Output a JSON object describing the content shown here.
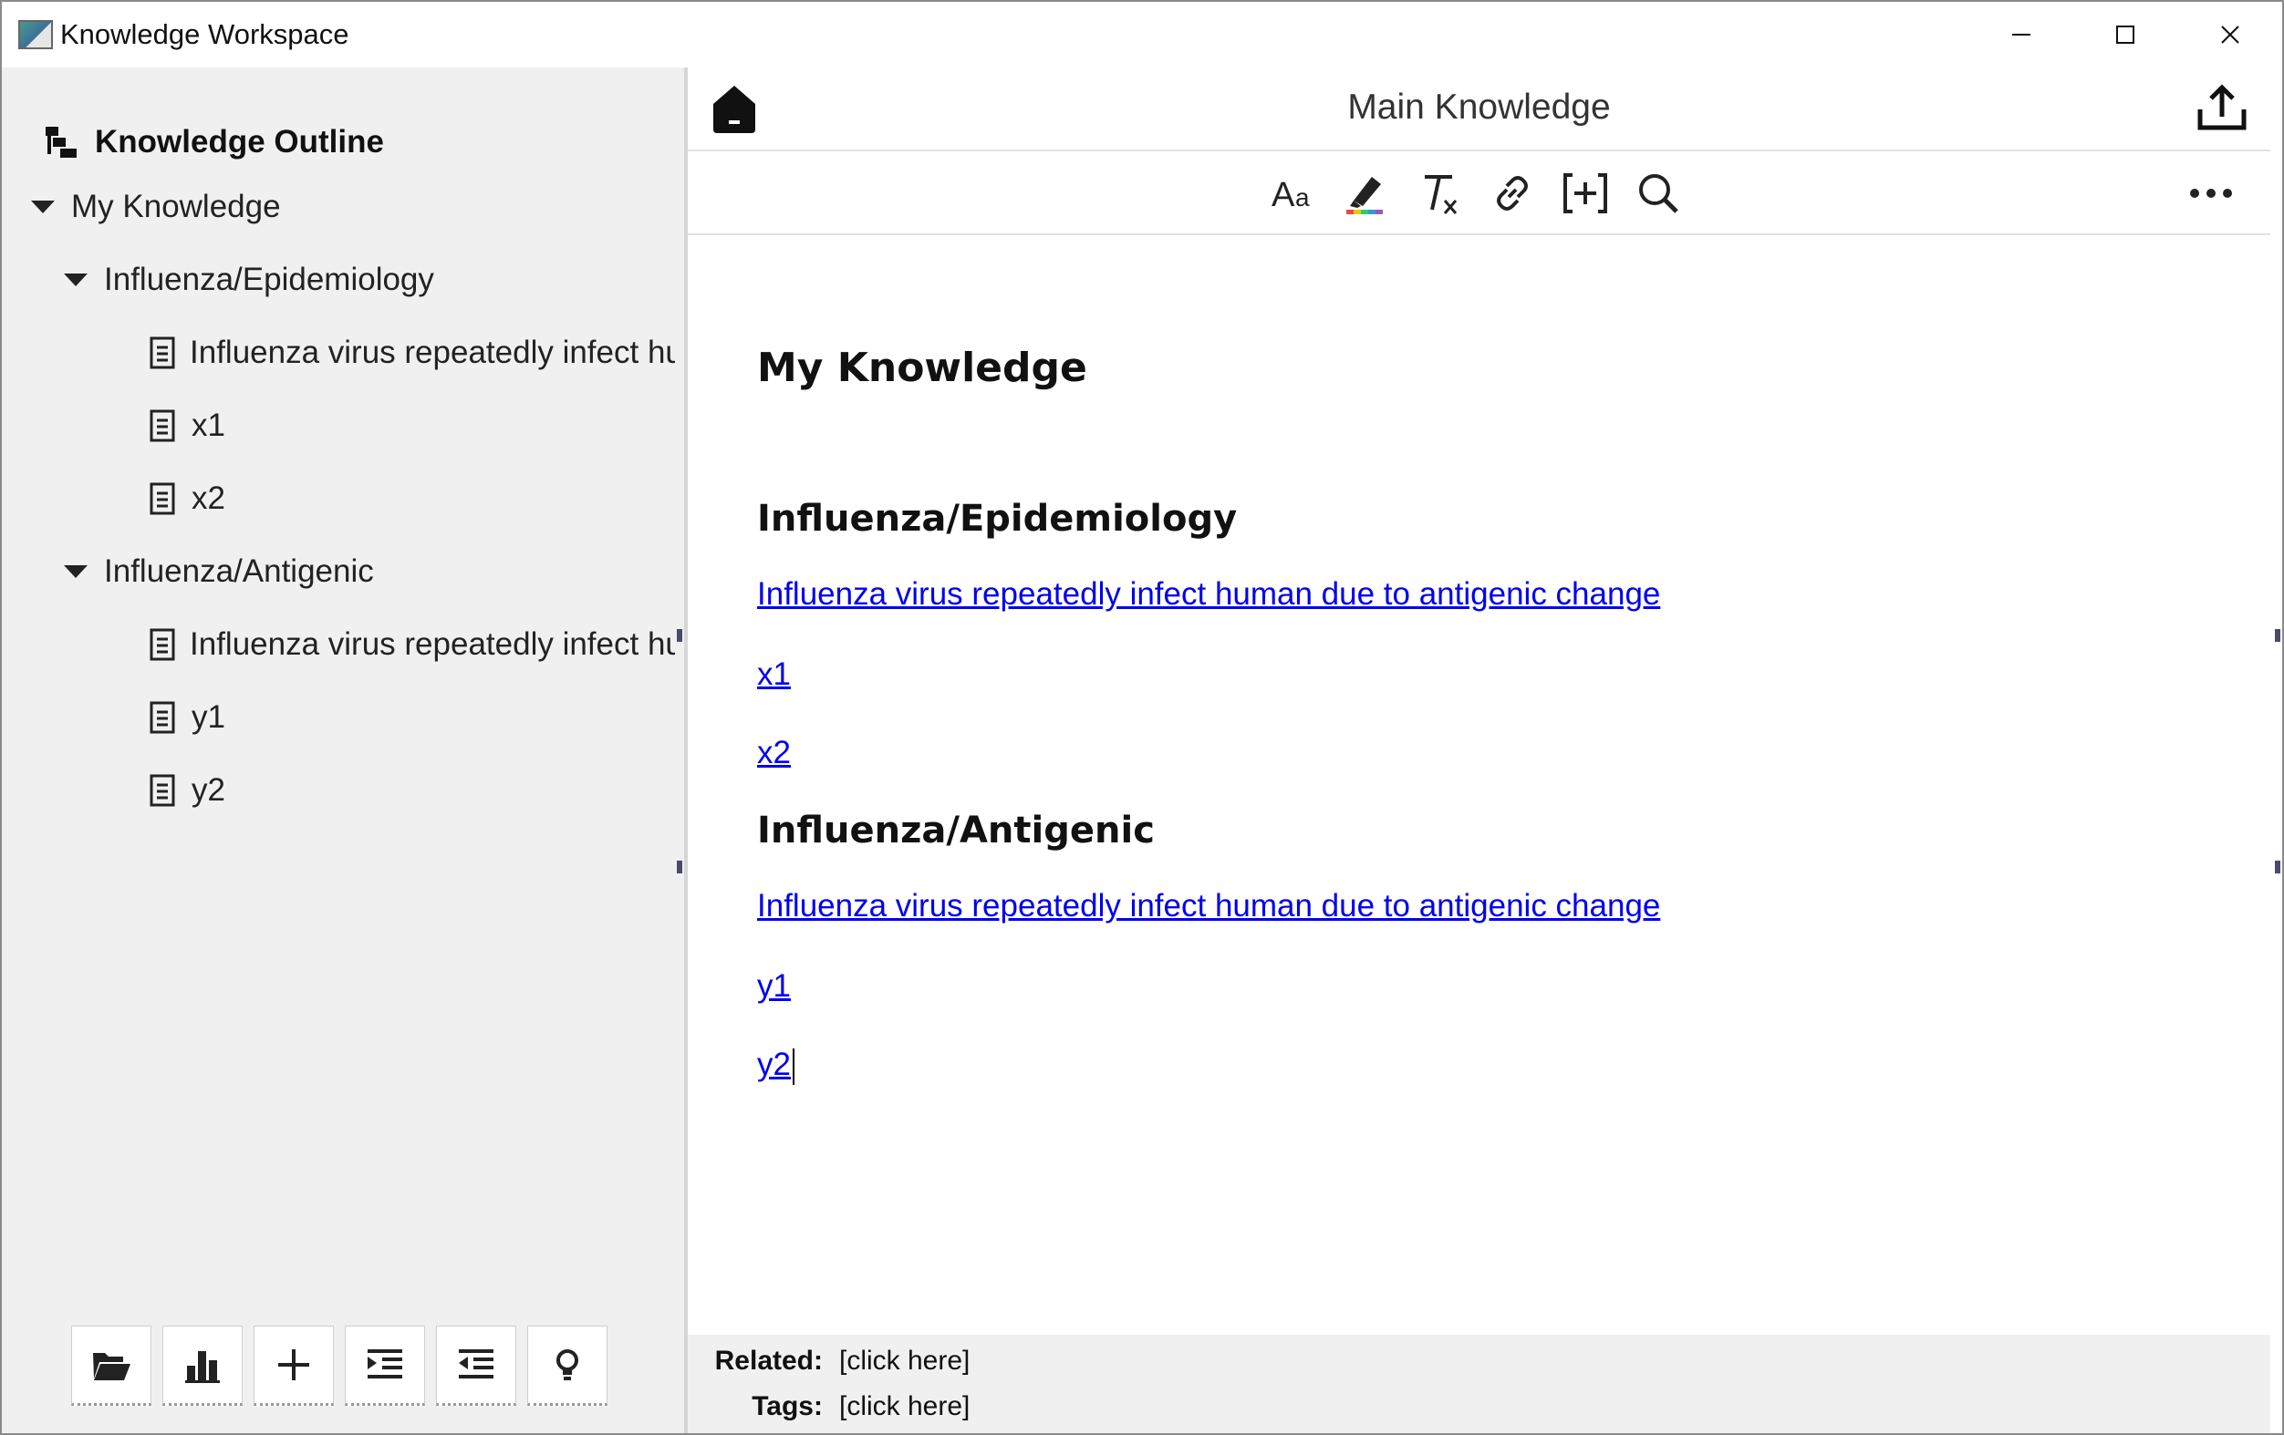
{
  "window": {
    "title": "Knowledge Workspace",
    "controls": {
      "minimize": "minimize-icon",
      "maximize": "maximize-icon",
      "close": "close-icon"
    }
  },
  "sidebar": {
    "title": "Knowledge Outline",
    "tree": [
      {
        "label": "My Knowledge",
        "level": 0,
        "type": "folder",
        "expanded": true
      },
      {
        "label": "Influenza/Epidemiology",
        "level": 1,
        "type": "folder",
        "expanded": true
      },
      {
        "label": "Influenza virus repeatedly infect human due to antigenic change",
        "level": 2,
        "type": "doc"
      },
      {
        "label": "x1",
        "level": 2,
        "type": "doc"
      },
      {
        "label": "x2",
        "level": 2,
        "type": "doc"
      },
      {
        "label": "Influenza/Antigenic",
        "level": 1,
        "type": "folder",
        "expanded": true
      },
      {
        "label": "Influenza virus repeatedly infect human due to antigenic change",
        "level": 2,
        "type": "doc"
      },
      {
        "label": "y1",
        "level": 2,
        "type": "doc"
      },
      {
        "label": "y2",
        "level": 2,
        "type": "doc"
      }
    ],
    "toolbar": [
      "open-folder-icon",
      "bar-chart-icon",
      "plus-icon",
      "indent-icon",
      "outdent-icon",
      "lightbulb-icon"
    ]
  },
  "editor": {
    "title": "Main Knowledge",
    "format_tools": [
      "font-size-icon",
      "highlighter-icon",
      "clear-format-icon",
      "link-icon",
      "insert-bracket-icon",
      "search-icon"
    ],
    "content": {
      "heading": "My Knowledge",
      "sections": [
        {
          "heading": "Influenza/Epidemiology",
          "links": [
            "Influenza virus repeatedly infect human due to antigenic change",
            "x1",
            "x2"
          ]
        },
        {
          "heading": "Influenza/Antigenic",
          "links": [
            "Influenza virus repeatedly infect human due to antigenic change",
            "y1",
            "y2"
          ]
        }
      ]
    },
    "meta": {
      "related_label": "Related:",
      "related_value": "[click here]",
      "tags_label": "Tags:",
      "tags_value": "[click here]"
    }
  },
  "colors": {
    "link": "#0000ee",
    "panel_bg": "#f0f0f0"
  }
}
